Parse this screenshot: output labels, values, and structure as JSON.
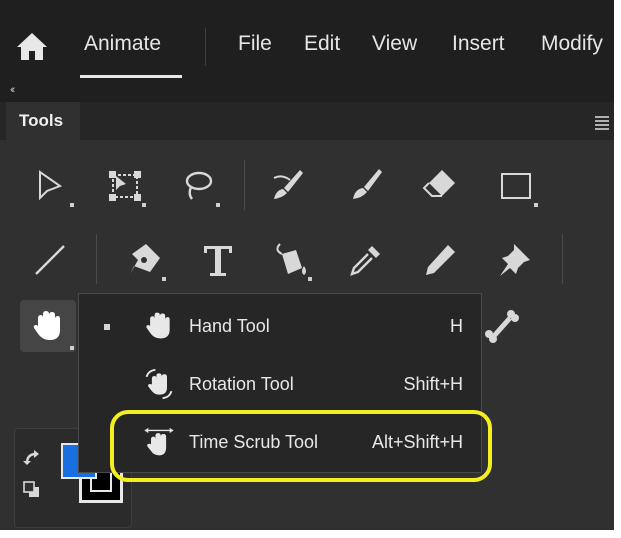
{
  "menubar": {
    "app_title": "Animate",
    "items": [
      "File",
      "Edit",
      "View",
      "Insert",
      "Modify"
    ]
  },
  "panel": {
    "title": "Tools"
  },
  "toolbar": {
    "row1": [
      "selection-tool-icon",
      "free-transform-tool-icon",
      "lasso-tool-icon",
      "brush-tool-icon",
      "paint-brush-tool-icon",
      "eraser-tool-icon",
      "rectangle-tool-icon"
    ],
    "row2": [
      "line-tool-icon",
      "pen-tool-icon",
      "text-tool-icon",
      "paint-bucket-tool-icon",
      "eyedropper-tool-icon",
      "pencil-tool-icon",
      "pin-tool-icon"
    ],
    "active_tool": "hand-tool-icon"
  },
  "flyout": {
    "items": [
      {
        "label": "Hand Tool",
        "shortcut": "H",
        "selected": true,
        "icon": "hand-icon"
      },
      {
        "label": "Rotation Tool",
        "shortcut": "Shift+H",
        "selected": false,
        "icon": "rotation-hand-icon"
      },
      {
        "label": "Time Scrub Tool",
        "shortcut": "Alt+Shift+H",
        "selected": false,
        "icon": "time-scrub-hand-icon"
      }
    ]
  },
  "colors": {
    "fill": "#1a6fe0",
    "stroke": "#000000",
    "highlight": "#f4ef1f"
  }
}
